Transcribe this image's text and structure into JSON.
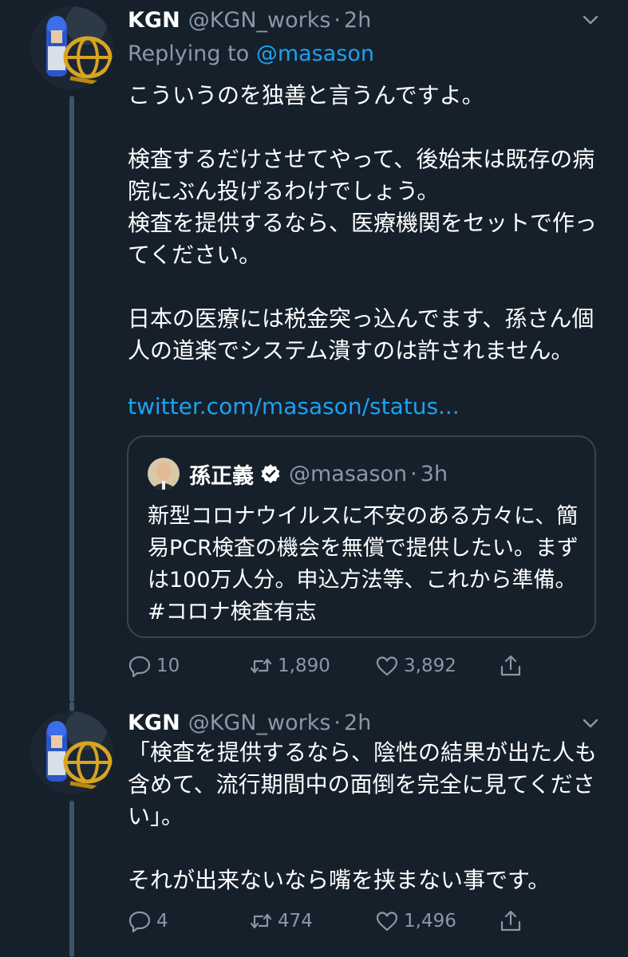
{
  "tweets": [
    {
      "name": "KGN",
      "handle": "@KGN_works",
      "dot": "·",
      "time": "2h",
      "replying_prefix": "Replying to",
      "replying_to": "@masason",
      "text": "こういうのを独善と言うんですよ。\n\n検査するだけさせてやって、後始末は既存の病院にぶん投げるわけでしょう。\n検査を提供するなら、医療機関をセットで作ってください。\n\n日本の医療には税金突っ込んでます、孫さん個人の道楽でシステム潰すのは許されません。",
      "link": "twitter.com/masason/status...",
      "quote": {
        "name": "孫正義",
        "handle": "@masason",
        "dot": "·",
        "time": "3h",
        "text": "新型コロナウイルスに不安のある方々に、簡易PCR検査の機会を無償で提供したい。まずは100万人分。申込方法等、これから準備。#コロナ検査有志"
      },
      "replies": "10",
      "retweets": "1,890",
      "likes": "3,892"
    },
    {
      "name": "KGN",
      "handle": "@KGN_works",
      "dot": "·",
      "time": "2h",
      "text": "「検査を提供するなら、陰性の結果が出た人も含めて、流行期間中の面倒を完全に見てください」。\n\nそれが出来ないなら嘴を挟まない事です。",
      "replies": "4",
      "retweets": "474",
      "likes": "1,496"
    }
  ],
  "colors": {
    "background": "#15202b",
    "secondary_text": "#8899a6",
    "link": "#1da1f2",
    "border": "#38444d"
  },
  "icons": [
    "chevron-down-icon",
    "reply-icon",
    "retweet-icon",
    "like-icon",
    "share-icon",
    "verified-badge-icon"
  ]
}
